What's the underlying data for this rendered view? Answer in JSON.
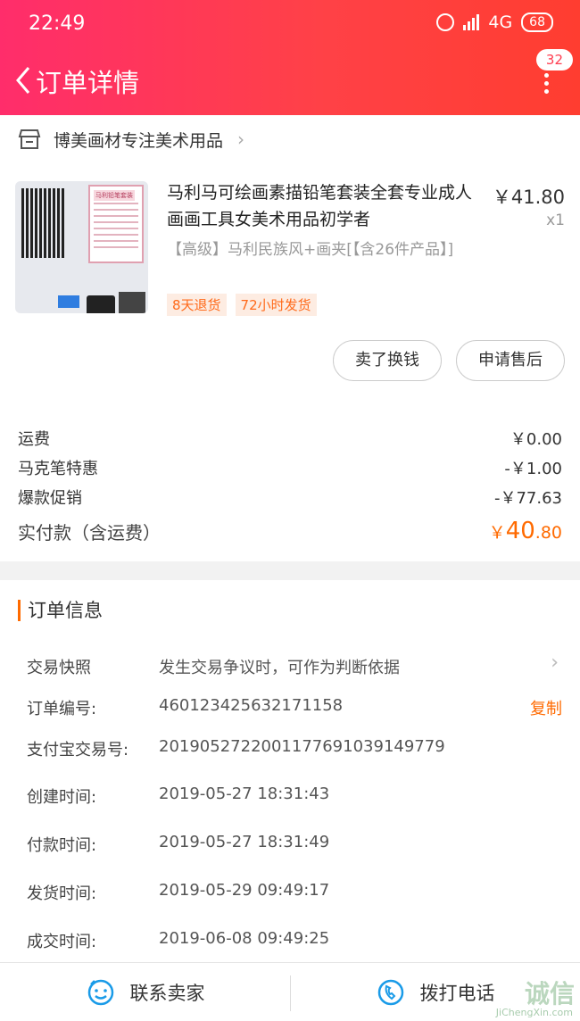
{
  "status_bar": {
    "time": "22:49",
    "network": "4G",
    "battery": "68"
  },
  "header": {
    "title": "订单详情",
    "message_count": "32"
  },
  "shop": {
    "name": "博美画材专注美术用品"
  },
  "product": {
    "title": "马利马可绘画素描铅笔套装全套专业成人画画工具女美术用品初学者",
    "price": "￥41.80",
    "quantity": "x1",
    "spec": "【高级】马利民族风+画夹[【含26件产品】]",
    "box_label": "马利铅笔套装",
    "tags": [
      "8天退货",
      "72小时发货"
    ]
  },
  "actions": {
    "sell": "卖了换钱",
    "after_sales": "申请售后"
  },
  "fees": [
    {
      "label": "运费",
      "value": "￥0.00"
    },
    {
      "label": "马克笔特惠",
      "value": "-￥1.00"
    },
    {
      "label": "爆款促销",
      "value": "-￥77.63"
    }
  ],
  "total": {
    "label": "实付款（含运费）",
    "currency": "￥",
    "integer": "40",
    "decimal": ".80"
  },
  "order_info": {
    "title": "订单信息",
    "rows": [
      {
        "label": "交易快照",
        "value": "发生交易争议时，可作为判断依据"
      },
      {
        "label": "订单编号:",
        "value": "460123425632171158"
      },
      {
        "label": "支付宝交易号:",
        "value": "2019052722001177691039149779"
      },
      {
        "label": "创建时间:",
        "value": "2019-05-27 18:31:43"
      },
      {
        "label": "付款时间:",
        "value": "2019-05-27 18:31:49"
      },
      {
        "label": "发货时间:",
        "value": "2019-05-29 09:49:17"
      },
      {
        "label": "成交时间:",
        "value": "2019-06-08 09:49:25"
      }
    ],
    "copy_label": "复制"
  },
  "bottom": {
    "contact_seller": "联系卖家",
    "call": "拨打电话"
  },
  "watermark": {
    "main": "诚信",
    "sub": "JiChengXin.com"
  },
  "colors": {
    "accent": "#ff6a00",
    "header_start": "#ff2d6b",
    "header_end": "#ff3d30"
  }
}
